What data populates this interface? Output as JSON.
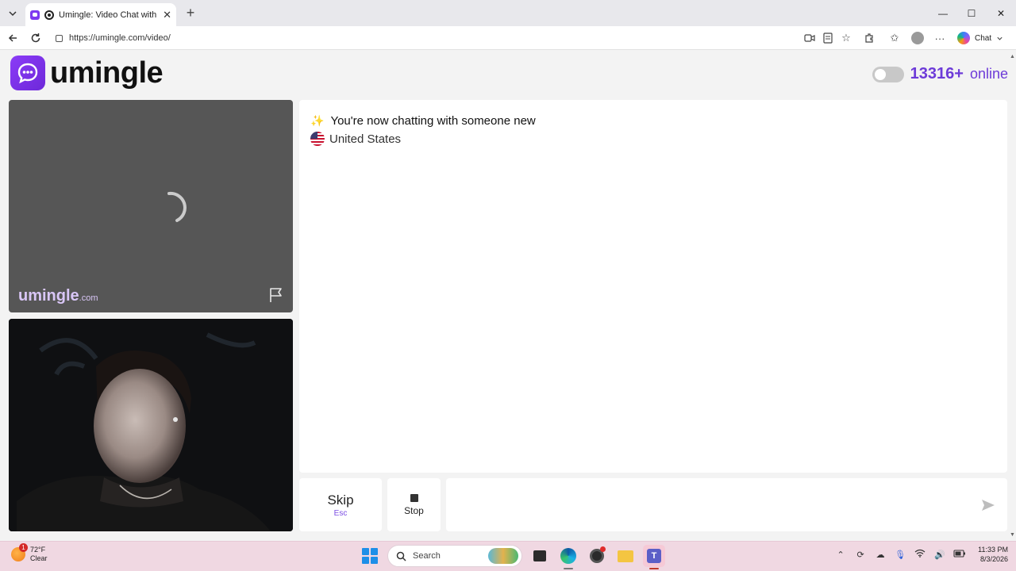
{
  "browser": {
    "tab_title": "Umingle: Video Chat with Stra",
    "url": "https://umingle.com/video/",
    "chat_label": "Chat"
  },
  "page": {
    "logo_text": "umingle",
    "online_count": "13316+",
    "online_label": "online",
    "watermark": "umingle",
    "watermark_sub": ".com",
    "messages": [
      {
        "emoji": "✨",
        "text": "You're now chatting with someone new"
      },
      {
        "flag": "us-flag",
        "text": "United States"
      }
    ],
    "skip_label": "Skip",
    "skip_hint": "Esc",
    "stop_label": "Stop",
    "chat_input_placeholder": ""
  },
  "taskbar": {
    "temperature": "72°F",
    "condition": "Clear",
    "weather_badge": "1",
    "search_label": "Search",
    "time": "11:33 PM",
    "date": "8/3/2026"
  },
  "colors": {
    "brand": "#7d39f0",
    "online_text": "#6d3bd8",
    "taskbar": "#f0d8e2"
  }
}
